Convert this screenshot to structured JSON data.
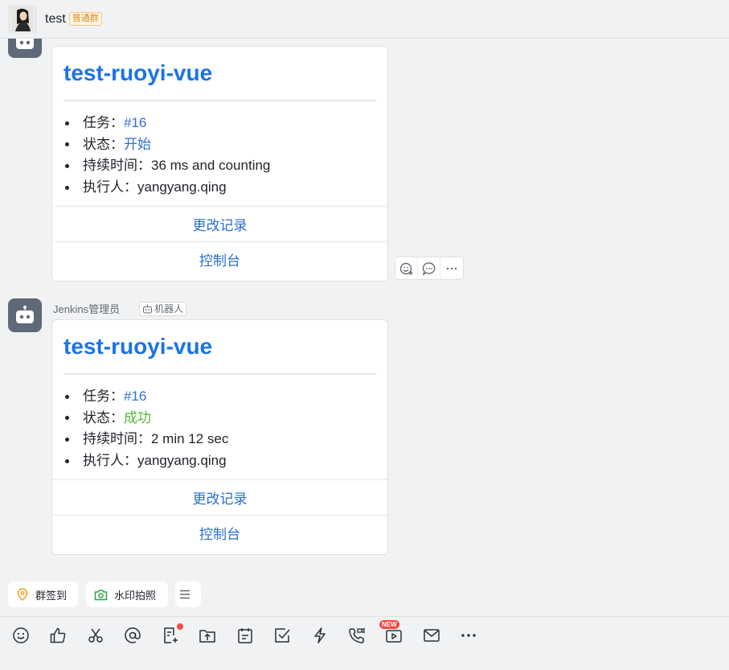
{
  "header": {
    "title": "test",
    "badge": "普通群"
  },
  "messages": [
    {
      "card": {
        "title": "test-ruoyi-vue",
        "items": [
          {
            "label": "任务：",
            "value": "#16"
          },
          {
            "label": "状态：",
            "value": "开始"
          },
          {
            "label": "持续时间：",
            "value": "36 ms and counting"
          },
          {
            "label": "执行人：",
            "value": "yangyang.qing"
          }
        ],
        "buttons": [
          "更改记录",
          "控制台"
        ]
      }
    },
    {
      "sender": "Jenkins管理员",
      "sender_tag": "机器人",
      "card": {
        "title": "test-ruoyi-vue",
        "items": [
          {
            "label": "任务：",
            "value": "#16"
          },
          {
            "label": "状态：",
            "value": "成功"
          },
          {
            "label": "持续时间：",
            "value": "2 min 12 sec"
          },
          {
            "label": "执行人：",
            "value": "yangyang.qing"
          }
        ],
        "buttons": [
          "更改记录",
          "控制台"
        ]
      }
    }
  ],
  "quick_actions": [
    "群签到",
    "水印拍照"
  ],
  "toolbar": {
    "new_badge": "NEW"
  },
  "colors": {
    "link": "#1a73e8",
    "success": "#52b43a",
    "bot_avatar": "#5f6977"
  }
}
